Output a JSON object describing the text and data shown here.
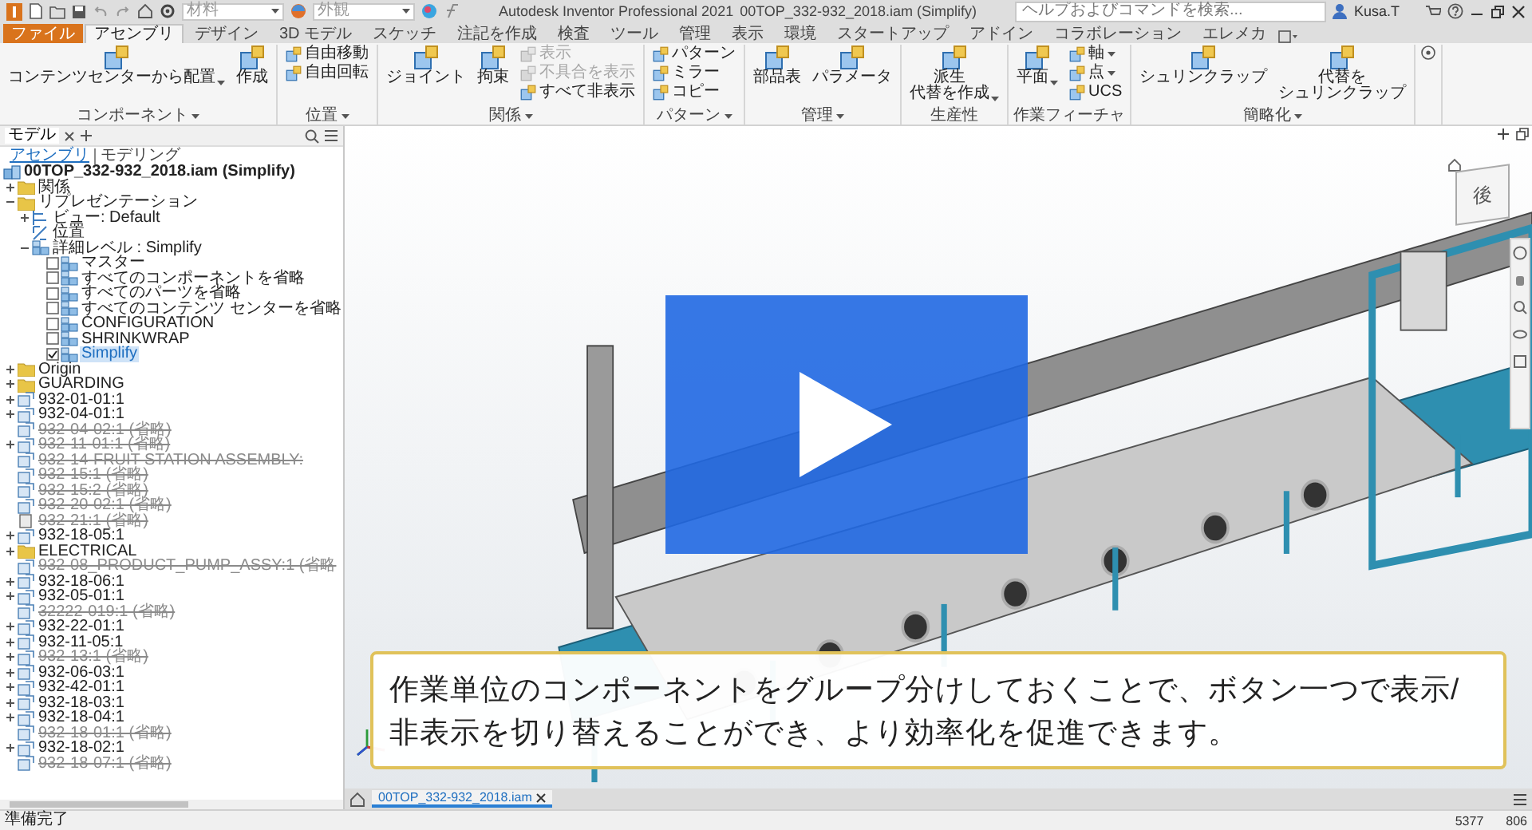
{
  "title_bar": {
    "material": {
      "placeholder": "材料"
    },
    "appearance": {
      "placeholder": "外観"
    },
    "app": "Autodesk Inventor Professional 2021",
    "document": "00TOP_332-932_2018.iam (Simplify)",
    "search": {
      "placeholder": "ヘルプおよびコマンドを検索..."
    },
    "user": "Kusa.T"
  },
  "tabs": [
    {
      "label": "ファイル",
      "kind": "file",
      "selected": false
    },
    {
      "label": "アセンブリ",
      "kind": "tab",
      "selected": true
    },
    {
      "label": "デザイン",
      "kind": "tab",
      "selected": false
    },
    {
      "label": "3D モデル",
      "kind": "tab",
      "selected": false
    },
    {
      "label": "スケッチ",
      "kind": "tab",
      "selected": false
    },
    {
      "label": "注記を作成",
      "kind": "tab",
      "selected": false
    },
    {
      "label": "検査",
      "kind": "tab",
      "selected": false
    },
    {
      "label": "ツール",
      "kind": "tab",
      "selected": false
    },
    {
      "label": "管理",
      "kind": "tab",
      "selected": false
    },
    {
      "label": "表示",
      "kind": "tab",
      "selected": false
    },
    {
      "label": "環境",
      "kind": "tab",
      "selected": false
    },
    {
      "label": "スタートアップ",
      "kind": "tab",
      "selected": false
    },
    {
      "label": "アドイン",
      "kind": "tab",
      "selected": false
    },
    {
      "label": "コラボレーション",
      "kind": "tab",
      "selected": false
    },
    {
      "label": "エレメカ",
      "kind": "tab",
      "selected": false
    }
  ],
  "ribbon": {
    "groups": [
      {
        "label": "コンポーネント",
        "dropdown": true,
        "tools": [
          {
            "lines": [
              "コンテンツセンターから配置"
            ],
            "kind": "large",
            "dropdown": true,
            "disabled": false
          },
          {
            "lines": [
              "作成"
            ],
            "kind": "large",
            "dropdown": false,
            "disabled": false
          }
        ]
      },
      {
        "label": "位置",
        "dropdown": true,
        "tools": [
          {
            "label": "自由移動",
            "kind": "small",
            "dropdown": false,
            "disabled": false
          },
          {
            "label": "自由回転",
            "kind": "small",
            "dropdown": false,
            "disabled": false
          }
        ]
      },
      {
        "label": "関係",
        "dropdown": true,
        "tools": [
          {
            "lines": [
              "ジョイント"
            ],
            "kind": "large",
            "dropdown": false,
            "disabled": false
          },
          {
            "lines": [
              "拘束"
            ],
            "kind": "large",
            "dropdown": false,
            "disabled": false
          },
          {
            "label": "表示",
            "kind": "small",
            "dropdown": false,
            "disabled": true
          },
          {
            "label": "不具合を表示",
            "kind": "small",
            "dropdown": false,
            "disabled": true
          },
          {
            "label": "すべて非表示",
            "kind": "small",
            "dropdown": false,
            "disabled": false
          }
        ]
      },
      {
        "label": "パターン",
        "dropdown": true,
        "tools": [
          {
            "label": "パターン",
            "kind": "small",
            "dropdown": false,
            "disabled": false
          },
          {
            "label": "ミラー",
            "kind": "small",
            "dropdown": false,
            "disabled": false
          },
          {
            "label": "コピー",
            "kind": "small",
            "dropdown": false,
            "disabled": false
          }
        ]
      },
      {
        "label": "管理",
        "dropdown": true,
        "tools": [
          {
            "lines": [
              "部品表"
            ],
            "kind": "large",
            "dropdown": false,
            "disabled": false
          },
          {
            "lines": [
              "パラメータ"
            ],
            "kind": "large",
            "dropdown": false,
            "disabled": false
          }
        ]
      },
      {
        "label": "生産性",
        "dropdown": false,
        "tools": [
          {
            "lines": [
              "派生",
              "代替を作成"
            ],
            "kind": "large",
            "dropdown": true,
            "disabled": false
          }
        ]
      },
      {
        "label": "作業フィーチャ",
        "dropdown": false,
        "tools": [
          {
            "lines": [
              "平面"
            ],
            "kind": "large",
            "dropdown": true,
            "disabled": false
          },
          {
            "label": "軸",
            "kind": "small",
            "dropdown": true,
            "disabled": false
          },
          {
            "label": "点",
            "kind": "small",
            "dropdown": true,
            "disabled": false
          },
          {
            "label": "UCS",
            "kind": "small",
            "dropdown": false,
            "disabled": false
          }
        ]
      },
      {
        "label": "簡略化",
        "dropdown": true,
        "tools": [
          {
            "lines": [
              "シュリンクラップ"
            ],
            "kind": "large",
            "dropdown": false,
            "disabled": false
          },
          {
            "lines": [
              "代替を",
              "シュリンクラップ"
            ],
            "kind": "large",
            "dropdown": false,
            "disabled": false
          }
        ]
      }
    ]
  },
  "browser": {
    "tabs": [
      {
        "label": "モデル",
        "selected": true
      }
    ],
    "modes": [
      {
        "label": "アセンブリ",
        "selected": true
      },
      {
        "label": "モデリング",
        "selected": false
      }
    ],
    "root": {
      "label": "00TOP_332-932_2018.iam (Simplify)",
      "kind": "assembly",
      "selected": false,
      "children": [
        {
          "label": "関係",
          "kind": "folder",
          "expanded": false,
          "suppressed": false,
          "selected": false
        },
        {
          "label": "リプレゼンテーション",
          "kind": "folder",
          "expanded": true,
          "suppressed": false,
          "selected": false,
          "children": [
            {
              "label": "ビュー: Default",
              "kind": "view",
              "expanded": false,
              "suppressed": false,
              "selected": false
            },
            {
              "label": "位置",
              "kind": "position",
              "suppressed": false,
              "selected": false
            },
            {
              "label": "詳細レベル : Simplify",
              "kind": "level",
              "expanded": true,
              "suppressed": false,
              "selected": false,
              "children": [
                {
                  "label": "マスター",
                  "kind": "level",
                  "suppressed": false,
                  "selected": false,
                  "active": false
                },
                {
                  "label": "すべてのコンポーネントを省略",
                  "kind": "level",
                  "suppressed": false,
                  "selected": false,
                  "active": false
                },
                {
                  "label": "すべてのパーツを省略",
                  "kind": "level",
                  "suppressed": false,
                  "selected": false,
                  "active": false
                },
                {
                  "label": "すべてのコンテンツ センターを省略",
                  "kind": "level",
                  "suppressed": false,
                  "selected": false,
                  "active": false
                },
                {
                  "label": "CONFIGURATION",
                  "kind": "level",
                  "suppressed": false,
                  "selected": false,
                  "active": false
                },
                {
                  "label": "SHRINKWRAP",
                  "kind": "level",
                  "suppressed": false,
                  "selected": false,
                  "active": false
                },
                {
                  "label": "Simplify",
                  "kind": "level",
                  "suppressed": false,
                  "selected": true,
                  "active": true
                }
              ]
            }
          ]
        },
        {
          "label": "Origin",
          "kind": "folder",
          "expanded": false,
          "suppressed": false,
          "selected": false
        },
        {
          "label": "GUARDING",
          "kind": "folder",
          "expanded": false,
          "suppressed": false,
          "selected": false
        },
        {
          "label": "932-01-01:1",
          "kind": "component",
          "expanded": false,
          "suppressed": false,
          "selected": false
        },
        {
          "label": "932-04-01:1",
          "kind": "component",
          "expanded": false,
          "suppressed": false,
          "selected": false
        },
        {
          "label": "932-04-02:1 (省略)",
          "kind": "component",
          "suppressed": true,
          "selected": false
        },
        {
          "label": "932-11-01:1 (省略)",
          "kind": "component",
          "expanded": false,
          "suppressed": true,
          "selected": false
        },
        {
          "label": "932-14-FRUIT STATION ASSEMBLY:",
          "kind": "component",
          "suppressed": true,
          "selected": false
        },
        {
          "label": "932-15:1 (省略)",
          "kind": "component",
          "suppressed": true,
          "selected": false
        },
        {
          "label": "932-15:2 (省略)",
          "kind": "component",
          "suppressed": true,
          "selected": false
        },
        {
          "label": "932-20-02:1 (省略)",
          "kind": "component",
          "suppressed": true,
          "selected": false
        },
        {
          "label": "932-21:1 (省略)",
          "kind": "part",
          "suppressed": true,
          "selected": false
        },
        {
          "label": "932-18-05:1",
          "kind": "component",
          "expanded": false,
          "suppressed": false,
          "selected": false
        },
        {
          "label": "ELECTRICAL",
          "kind": "folder",
          "expanded": false,
          "suppressed": false,
          "selected": false
        },
        {
          "label": "932-08_PRODUCT_PUMP_ASSY:1 (省略",
          "kind": "component",
          "suppressed": true,
          "selected": false
        },
        {
          "label": "932-18-06:1",
          "kind": "component",
          "expanded": false,
          "suppressed": false,
          "selected": false
        },
        {
          "label": "932-05-01:1",
          "kind": "component",
          "expanded": false,
          "suppressed": false,
          "selected": false
        },
        {
          "label": "32222-019:1 (省略)",
          "kind": "component",
          "suppressed": true,
          "selected": false
        },
        {
          "label": "932-22-01:1",
          "kind": "component",
          "expanded": false,
          "suppressed": false,
          "selected": false
        },
        {
          "label": "932-11-05:1",
          "kind": "component",
          "expanded": false,
          "suppressed": false,
          "selected": false
        },
        {
          "label": "932-13:1 (省略)",
          "kind": "component",
          "expanded": false,
          "suppressed": true,
          "selected": false
        },
        {
          "label": "932-06-03:1",
          "kind": "component",
          "expanded": false,
          "suppressed": false,
          "selected": false
        },
        {
          "label": "932-42-01:1",
          "kind": "component",
          "expanded": false,
          "suppressed": false,
          "selected": false
        },
        {
          "label": "932-18-03:1",
          "kind": "component",
          "expanded": false,
          "suppressed": false,
          "selected": false
        },
        {
          "label": "932-18-04:1",
          "kind": "component",
          "expanded": false,
          "suppressed": false,
          "selected": false
        },
        {
          "label": "932-18-01:1 (省略)",
          "kind": "component",
          "suppressed": true,
          "selected": false
        },
        {
          "label": "932-18-02:1",
          "kind": "component",
          "expanded": false,
          "suppressed": false,
          "selected": false
        },
        {
          "label": "932-18-07:1 (省略)",
          "kind": "component",
          "suppressed": true,
          "selected": false
        }
      ]
    }
  },
  "viewport": {
    "view_cube": "後",
    "caption": "作業単位のコンポーネントをグループ分けしておくことで、ボタン一つで表示/非表示を切り替えることができ、より効率化を促進できます。"
  },
  "document_tabs": [
    {
      "label": "00TOP_332-932_2018.iam",
      "selected": true
    }
  ],
  "status_bar": {
    "message": "準備完了",
    "counts": [
      "5377",
      "806"
    ]
  }
}
